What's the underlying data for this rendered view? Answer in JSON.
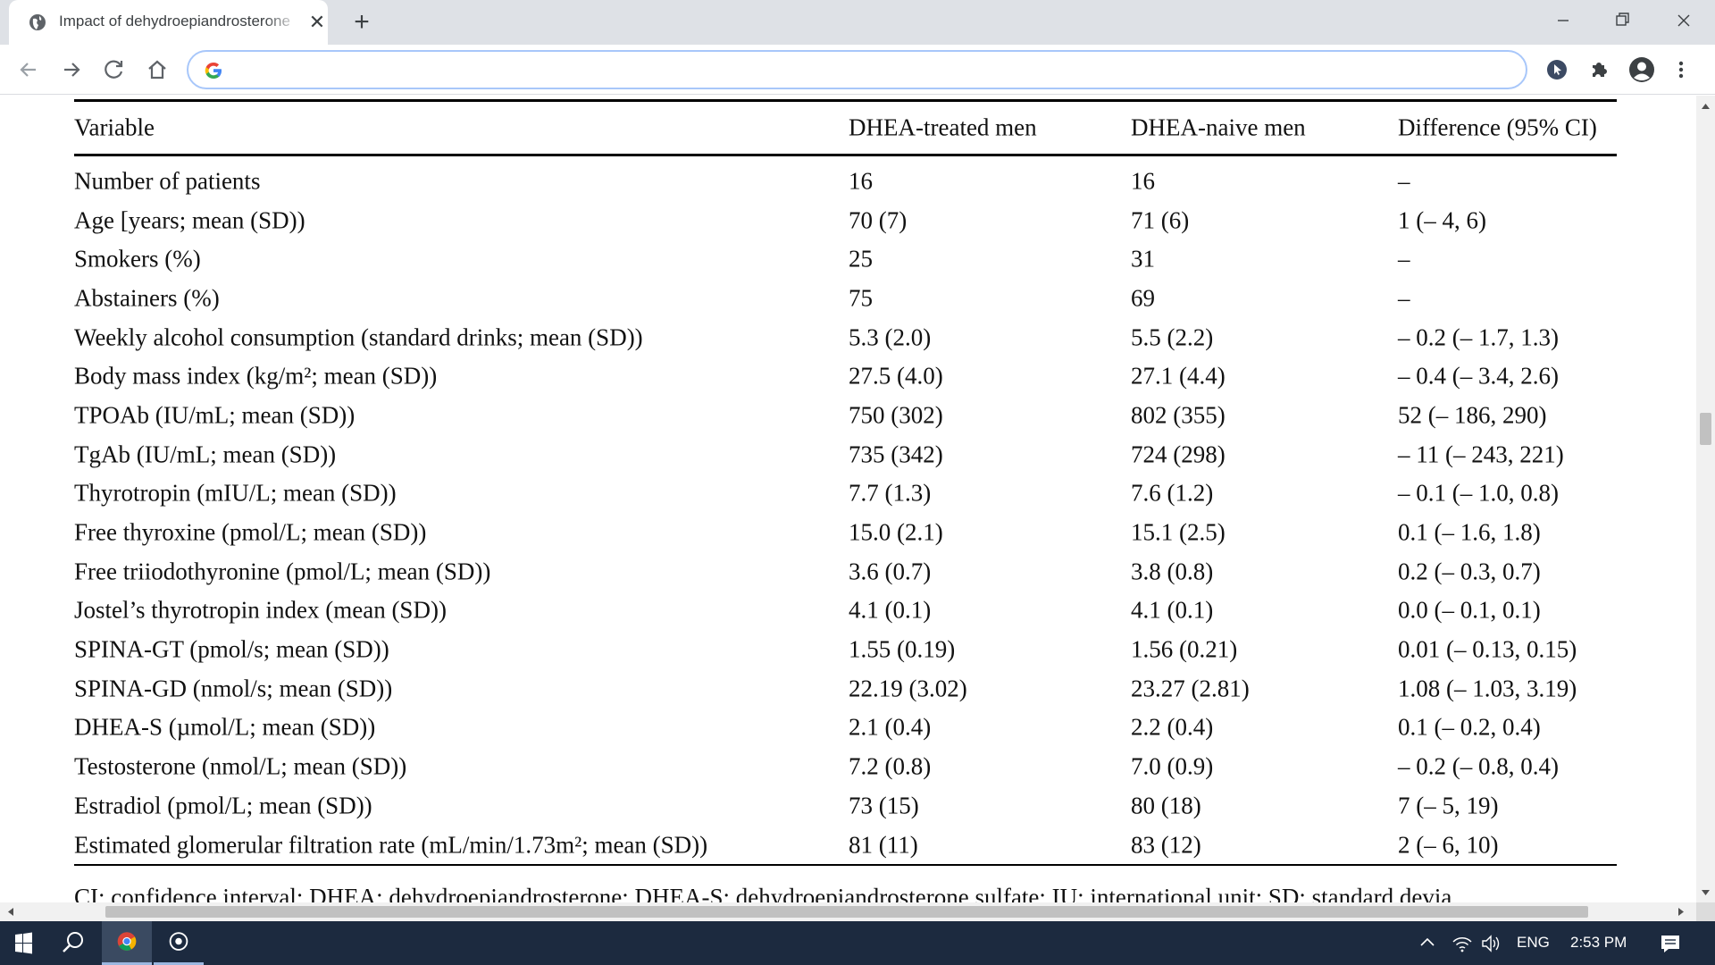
{
  "browser": {
    "tab_title": "Impact of dehydroepiandrosterone",
    "tab_close_icon": "close-icon",
    "new_tab_icon": "plus-icon",
    "address_value": "",
    "address_placeholder": "",
    "toolbar_icons": [
      "back-arrow-icon",
      "forward-arrow-icon",
      "reload-icon",
      "home-icon",
      "google-g-icon",
      "extension-cursor-icon",
      "puzzle-icon",
      "profile-icon",
      "kebab-menu-icon"
    ]
  },
  "table": {
    "headers": [
      "Variable",
      "DHEA-treated men",
      "DHEA-naive men",
      "Difference (95% CI)"
    ],
    "rows": [
      [
        "Number of patients",
        "16",
        "16",
        "–"
      ],
      [
        "Age [years; mean (SD))",
        "70 (7)",
        "71 (6)",
        "1 (– 4, 6)"
      ],
      [
        "Smokers (%)",
        "25",
        "31",
        "–"
      ],
      [
        "Abstainers (%)",
        "75",
        "69",
        "–"
      ],
      [
        "Weekly alcohol consumption (standard drinks; mean (SD))",
        "5.3 (2.0)",
        "5.5 (2.2)",
        "– 0.2 (– 1.7, 1.3)"
      ],
      [
        "Body mass index (kg/m²; mean (SD))",
        "27.5 (4.0)",
        "27.1 (4.4)",
        "– 0.4 (– 3.4, 2.6)"
      ],
      [
        "TPOAb (IU/mL; mean (SD))",
        "750 (302)",
        "802 (355)",
        "52 (– 186, 290)"
      ],
      [
        "TgAb (IU/mL; mean (SD))",
        "735 (342)",
        "724 (298)",
        "– 11 (– 243, 221)"
      ],
      [
        "Thyrotropin (mIU/L; mean (SD))",
        "7.7 (1.3)",
        "7.6 (1.2)",
        "– 0.1 (– 1.0, 0.8)"
      ],
      [
        "Free thyroxine (pmol/L; mean (SD))",
        "15.0 (2.1)",
        "15.1 (2.5)",
        "0.1 (– 1.6, 1.8)"
      ],
      [
        "Free triiodothyronine (pmol/L; mean (SD))",
        "3.6 (0.7)",
        "3.8 (0.8)",
        "0.2 (– 0.3, 0.7)"
      ],
      [
        "Jostel’s thyrotropin index (mean (SD))",
        "4.1 (0.1)",
        "4.1 (0.1)",
        "0.0 (– 0.1, 0.1)"
      ],
      [
        "SPINA-GT (pmol/s; mean (SD))",
        "1.55 (0.19)",
        "1.56 (0.21)",
        "0.01 (– 0.13, 0.15)"
      ],
      [
        "SPINA-GD (nmol/s; mean (SD))",
        "22.19 (3.02)",
        "23.27 (2.81)",
        "1.08 (– 1.03, 3.19)"
      ],
      [
        "DHEA-S (µmol/L; mean (SD))",
        "2.1 (0.4)",
        "2.2 (0.4)",
        "0.1 (– 0.2, 0.4)"
      ],
      [
        "Testosterone (nmol/L; mean (SD))",
        "7.2 (0.8)",
        "7.0 (0.9)",
        "– 0.2 (– 0.8, 0.4)"
      ],
      [
        "Estradiol (pmol/L; mean (SD))",
        "73 (15)",
        "80 (18)",
        "7 (– 5, 19)"
      ],
      [
        "Estimated glomerular filtration rate (mL/min/1.73m²; mean (SD))",
        "81 (11)",
        "83 (12)",
        "2 (– 6, 10)"
      ]
    ],
    "footnote": "CI: confidence interval; DHEA: dehydroepiandrosterone; DHEA-S: dehydroepiandrosterone sulfate; IU: international unit; SD: standard devia"
  },
  "taskbar": {
    "language": "ENG",
    "time": "2:53 PM",
    "icons": [
      "windows-start-icon",
      "search-icon",
      "chrome-icon",
      "app-icon",
      "chevron-up-icon",
      "wifi-icon",
      "volume-icon",
      "notification-icon"
    ]
  },
  "colors": {
    "tabstrip": "#dee1e6",
    "omnibox_border": "#a8c7fa",
    "taskbar": "#1c2a3f",
    "text": "#111111"
  }
}
